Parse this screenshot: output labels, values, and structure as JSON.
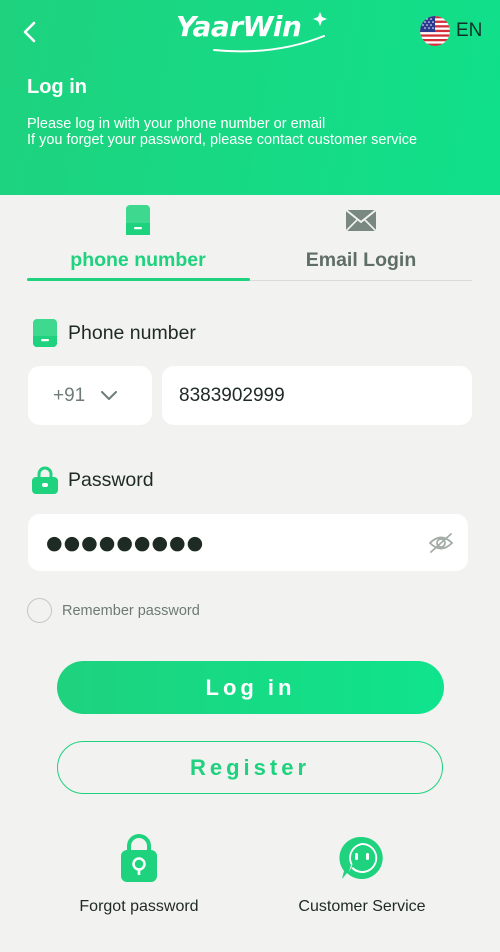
{
  "header": {
    "logo_text": "YaarWin",
    "language": "EN",
    "title": "Log in",
    "subtitle_line1": "Please log in with your phone number or email",
    "subtitle_line2": "If you forget your password, please contact customer service"
  },
  "tabs": [
    {
      "label": "phone number",
      "icon": "phone-icon",
      "active": true
    },
    {
      "label": "Email Login",
      "icon": "envelope-icon",
      "active": false
    }
  ],
  "phone_field": {
    "label": "Phone number",
    "country_code": "+91",
    "value": "8383902999"
  },
  "password_field": {
    "label": "Password",
    "value": "●●●●●●●●●"
  },
  "remember": {
    "label": "Remember password",
    "checked": false
  },
  "buttons": {
    "login": "Log in",
    "register": "Register"
  },
  "bottom_links": {
    "forgot": "Forgot password",
    "service": "Customer Service"
  },
  "colors": {
    "brand": "#1ed27e",
    "background": "#f2f2f1",
    "card": "#ffffff"
  }
}
